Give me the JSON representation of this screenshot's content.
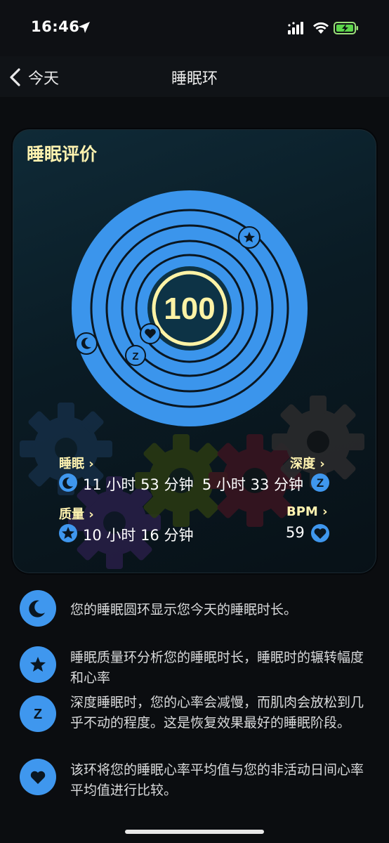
{
  "status_bar": {
    "time": "16:46"
  },
  "nav": {
    "back_label": "今天",
    "title": "睡眠环"
  },
  "card": {
    "title": "睡眠评价",
    "score": "100",
    "stats": {
      "sleep": {
        "label": "睡眠 ›",
        "value": "11 小时 53 分钟"
      },
      "deep": {
        "label": "深度 ›",
        "value": "5 小时 33 分钟"
      },
      "quality": {
        "label": "质量 ›",
        "value": "10 小时 16 分钟"
      },
      "bpm": {
        "label": "BPM ›",
        "value": "59"
      }
    }
  },
  "legend": [
    {
      "icon": "moon-icon",
      "text": "您的睡眠圆环显示您今天的睡眠时长。"
    },
    {
      "icon": "star-icon",
      "text": "睡眠质量环分析您的睡眠时长，睡眠时的辗转幅度和心率"
    },
    {
      "icon": "z-icon",
      "text": "深度睡眠时，您的心率会减慢，而肌肉会放松到几乎不动的程度。这是恢复效果最好的睡眠阶段。"
    },
    {
      "icon": "heart-icon",
      "text": "该环将您的睡眠心率平均值与您的非活动日间心率平均值进行比较。"
    }
  ],
  "colors": {
    "accent": "#3f97ee",
    "title_yellow": "#fff3b0",
    "score_bg": "#0d3346",
    "score_ring": "#fff3a6"
  }
}
